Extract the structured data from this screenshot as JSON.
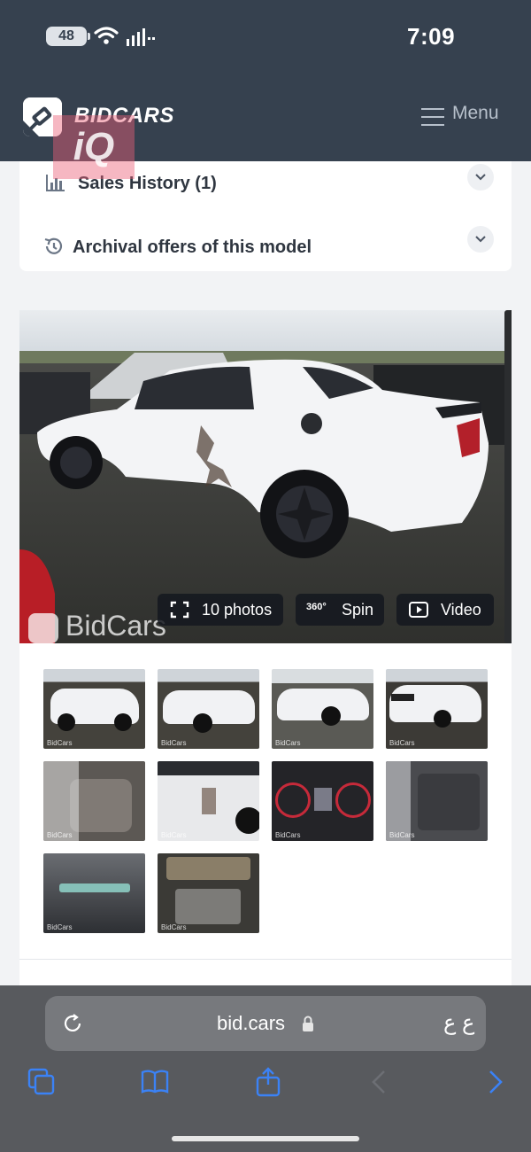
{
  "status_bar": {
    "battery": "48",
    "time": "7:09"
  },
  "header": {
    "brand": "BIDCARS",
    "menu_label": "Menu",
    "overlay_watermark": "iQ"
  },
  "accordion": {
    "items": [
      {
        "label": "Sales History (1)",
        "icon": "bar-chart-icon"
      },
      {
        "label": "Archival offers of this model",
        "icon": "history-icon"
      }
    ]
  },
  "gallery": {
    "photos_label": "10 photos",
    "spin_label": "Spin",
    "spin_badge": "360°",
    "video_label": "Video",
    "watermark": "BidCars",
    "thumb_watermark": "BidCars",
    "thumbnail_count": 10
  },
  "browser": {
    "url": "bid.cars",
    "text_size_button": "ع ع",
    "toolbar": [
      "tabs-icon",
      "bookmarks-icon",
      "share-icon",
      "back-icon",
      "forward-icon"
    ]
  },
  "colors": {
    "header_bg": "#36414f",
    "accent_blue": "#3b82f6",
    "browser_bar": "#585a5e"
  }
}
